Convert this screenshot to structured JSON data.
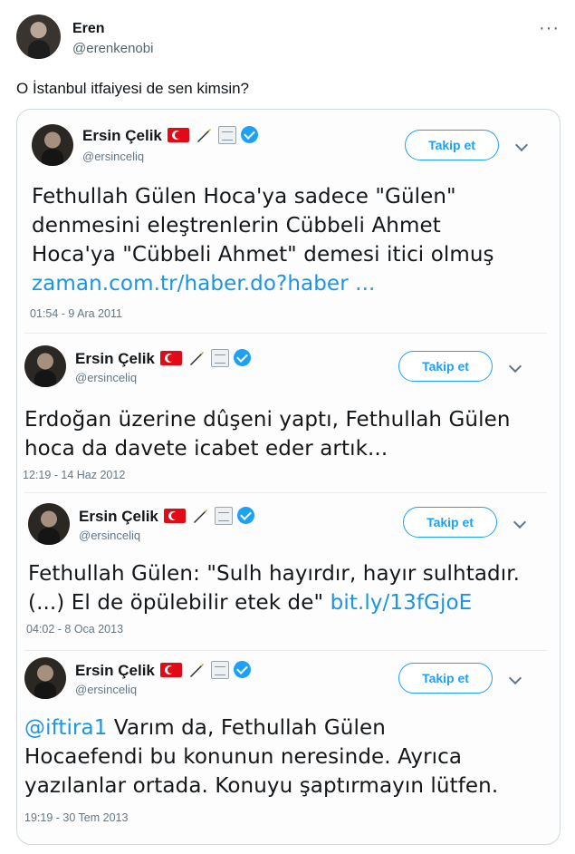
{
  "post": {
    "author_name": "Eren",
    "author_handle": "@erenkenobi",
    "text": "O İstanbul itfaiyesi de sen kimsin?"
  },
  "embedded_tweets": [
    {
      "name": "Ersin Çelik",
      "handle": "@ersinceliq",
      "follow_label": "Takip et",
      "text_lines": [
        "Fethullah Gülen Hoca'ya sadece \"Gülen\"",
        "denmesini eleştrenlerin Cübbeli Ahmet",
        "Hoca'ya \"Cübbeli Ahmet\" demesi itici olmuş"
      ],
      "link": "zaman.com.tr/haber.do?haber  ...",
      "timestamp": "01:54 - 9 Ara 2011"
    },
    {
      "name": "Ersin Çelik",
      "handle": "@ersinceliq",
      "follow_label": "Takip et",
      "text_lines": [
        "Erdoğan üzerine dûşeni yaptı, Fethullah Gülen",
        "hoca da davete icabet eder artık..."
      ],
      "timestamp": "12:19 - 14 Haz 2012"
    },
    {
      "name": "Ersin Çelik",
      "handle": "@ersinceliq",
      "follow_label": "Takip et",
      "text_lines": [
        "Fethullah Gülen: \"Sulh hayırdır, hayır sulhtadır.",
        "(...) El de öpülebilir etek de\""
      ],
      "link": "bit.ly/13fGjoE",
      "timestamp": "04:02 - 8 Oca 2013"
    },
    {
      "name": "Ersin Çelik",
      "handle": "@ersinceliq",
      "follow_label": "Takip et",
      "mention": "@iftira1",
      "text_lines": [
        "Varım da, Fethullah Gülen",
        "Hocaefendi bu konunun neresinde. Ayrıca",
        "yazılanlar ortada. Konuyu şaptırmayın lütfen."
      ],
      "timestamp": "19:19 - 30 Tem 2013"
    }
  ],
  "icons": {
    "more": "more-horizontal-icon",
    "flag": "turkish-flag-icon",
    "pen": "fountain-pen-icon",
    "note": "notepad-icon",
    "verified": "verified-badge-icon",
    "chevron": "chevron-down-icon"
  },
  "colors": {
    "link": "#1b95e0",
    "verified": "#1da1f2",
    "flag": "#e30a17"
  }
}
